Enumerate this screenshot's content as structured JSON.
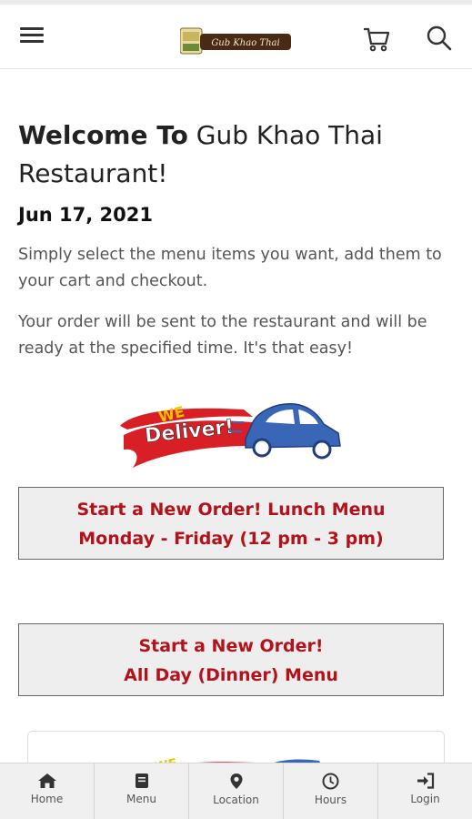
{
  "header": {
    "logo_text": "Gub Khao Thai"
  },
  "welcome": {
    "bold": "Welcome To",
    "rest": " Gub Khao Thai Restaurant!"
  },
  "date": "Jun 17, 2021",
  "intro": {
    "line1": "Simply select the menu items you want, add them to your cart and checkout.",
    "line2": "Your order will be sent to the restaurant and will be ready at the specified time. It's that easy!"
  },
  "deliver": {
    "we": "WE",
    "deliver": "Deliver!"
  },
  "buttons": {
    "lunch_line1": "Start a New Order! Lunch Menu",
    "lunch_line2": "Monday - Friday (12 pm - 3 pm)",
    "dinner_line1": "Start a New Order!",
    "dinner_line2": "All Day (Dinner) Menu"
  },
  "bottom_nav": {
    "home": "Home",
    "menu": "Menu",
    "location": "Location",
    "hours": "Hours",
    "login": "Login"
  },
  "colors": {
    "accent": "#b3121b",
    "button_bg": "#eeeeee",
    "nav_bg": "#f0f0f0"
  },
  "icons": [
    "hamburger-icon",
    "cart-icon",
    "search-icon",
    "home-icon",
    "menu-book-icon",
    "location-pin-icon",
    "clock-icon",
    "login-icon"
  ]
}
